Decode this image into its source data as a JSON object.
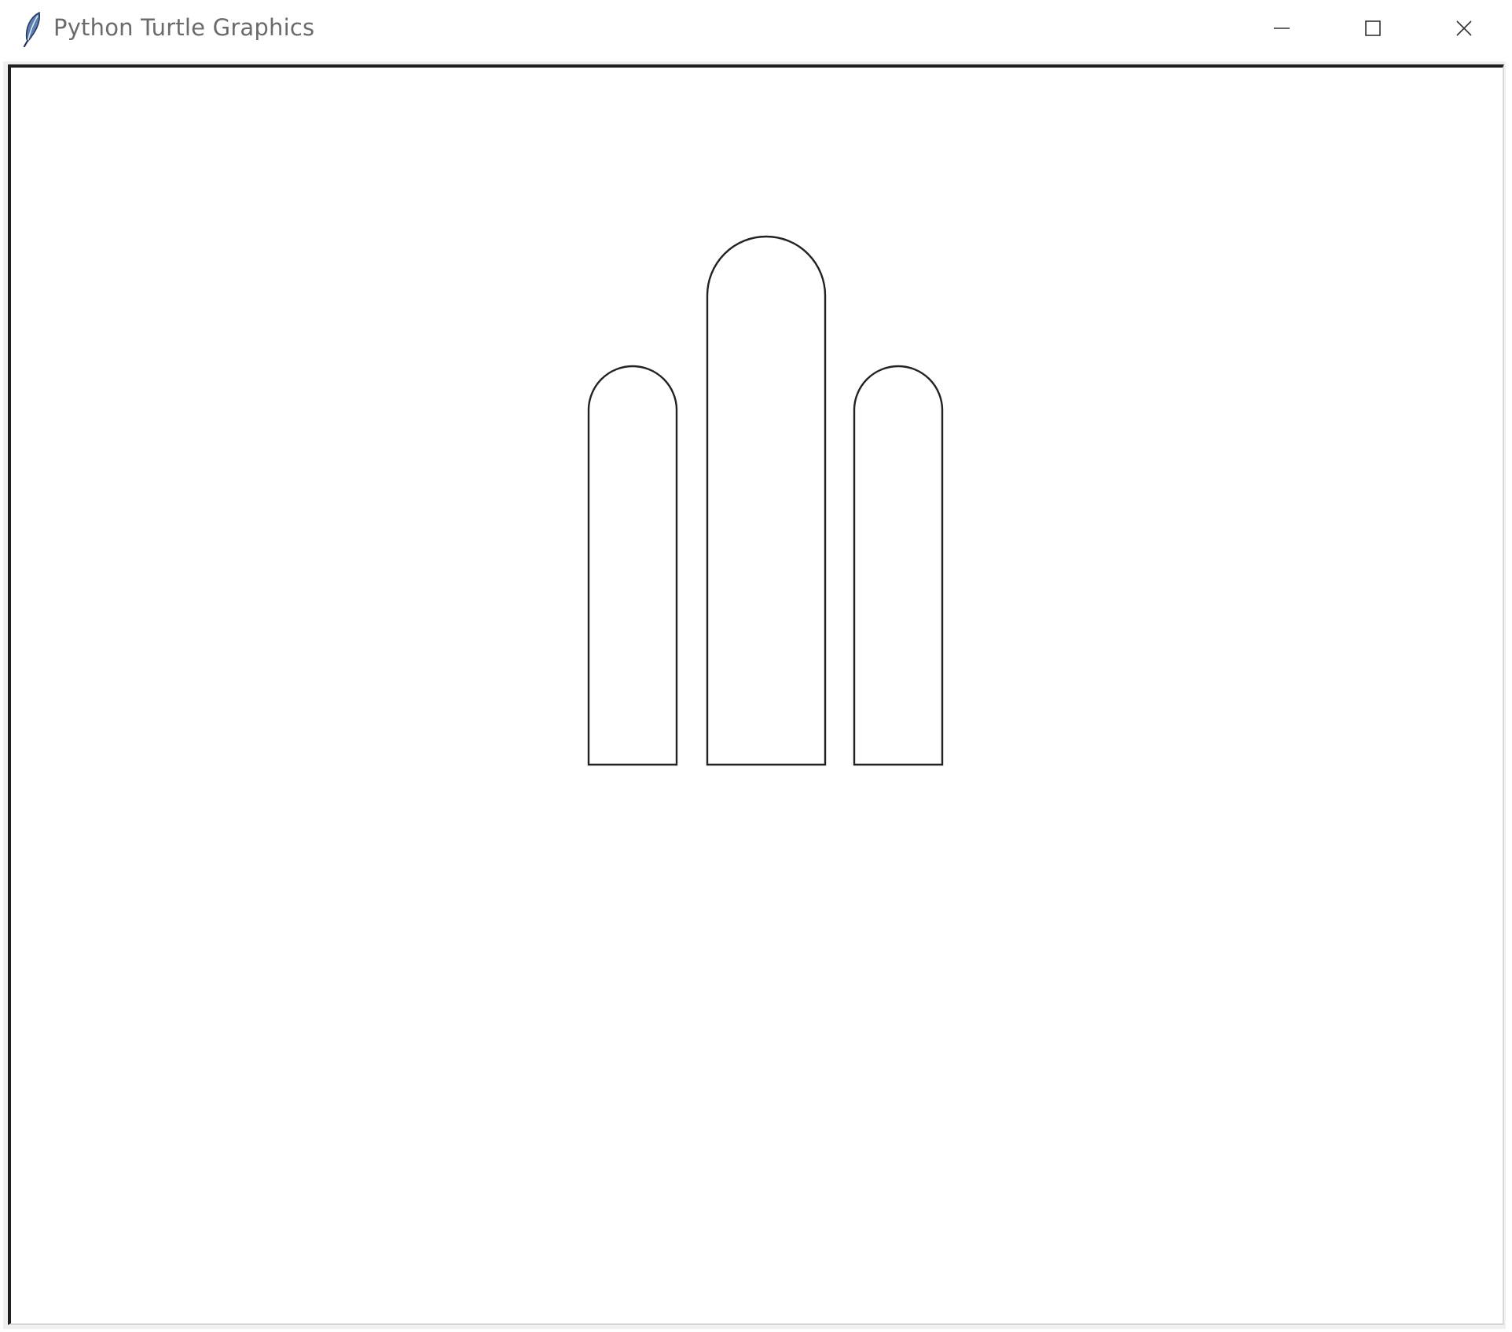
{
  "window": {
    "title": "Python Turtle Graphics",
    "icon": "feather-icon",
    "controls": {
      "minimize": "minimize-icon",
      "maximize": "maximize-icon",
      "close": "close-icon"
    }
  },
  "canvas": {
    "background": "#ffffff",
    "pen_color": "#222222",
    "shapes": [
      {
        "name": "left-arch",
        "icon": "arch-shape"
      },
      {
        "name": "middle-arch",
        "icon": "arch-shape"
      },
      {
        "name": "right-arch",
        "icon": "arch-shape"
      }
    ]
  }
}
